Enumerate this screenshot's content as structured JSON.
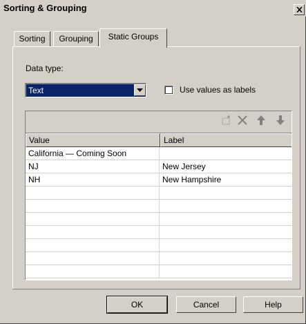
{
  "window": {
    "title": "Sorting & Grouping",
    "close_icon": "close-icon"
  },
  "tabs": [
    {
      "label": "Sorting",
      "active": false
    },
    {
      "label": "Grouping",
      "active": false
    },
    {
      "label": "Static Groups",
      "active": true
    }
  ],
  "static_groups": {
    "data_type_label": "Data type:",
    "data_type_value": "Text",
    "use_values_label": "Use values as labels",
    "use_values_checked": false,
    "toolbar_icons": [
      "new-row-icon",
      "delete-icon",
      "move-up-icon",
      "move-down-icon"
    ],
    "grid": {
      "columns": [
        "Value",
        "Label"
      ],
      "rows": [
        [
          "California — Coming Soon",
          ""
        ],
        [
          "NJ",
          "New Jersey"
        ],
        [
          "NH",
          "New Hampshire"
        ],
        [
          "",
          ""
        ],
        [
          "",
          ""
        ],
        [
          "",
          ""
        ],
        [
          "",
          ""
        ],
        [
          "",
          ""
        ],
        [
          "",
          ""
        ],
        [
          "",
          ""
        ]
      ]
    }
  },
  "buttons": {
    "ok": "OK",
    "cancel": "Cancel",
    "help": "Help"
  }
}
